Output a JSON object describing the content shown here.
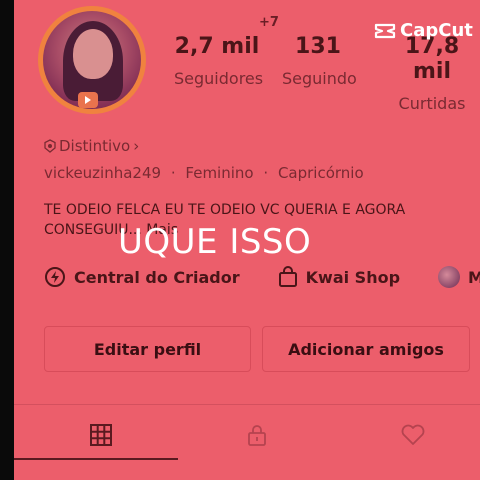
{
  "overlay": {
    "capcut_label": "CapCut",
    "caption": "UQUE ISSO"
  },
  "profile": {
    "story_badge": "+7",
    "stats": [
      {
        "value": "2,7 mil",
        "label": "Seguidores"
      },
      {
        "value": "131",
        "label": "Seguindo"
      },
      {
        "value": "17,8 mil",
        "label": "Curtidas"
      }
    ],
    "badge_label": "Distintivo",
    "badge_chevron": "›",
    "username": "vickeuzinha249",
    "gender": "Feminino",
    "sign": "Capricórnio",
    "info_separator": "·",
    "bio_line1": "TE ODEIO FELCA EU TE ODEIO VC QUERIA E AGORA",
    "bio_line2": "CONSEGUIU... Mais"
  },
  "links": [
    {
      "label": "Central do Criador",
      "icon": "lightning-icon"
    },
    {
      "label": "Kwai Shop",
      "icon": "shopping-bag-icon"
    },
    {
      "label": "Minha",
      "icon": "avatar-icon"
    }
  ],
  "actions": {
    "edit_label": "Editar perfil",
    "add_label": "Adicionar amigos"
  },
  "tabs": [
    "grid-icon",
    "lock-icon",
    "heart-icon"
  ],
  "colors": {
    "overlay_tint": "#ec5e6b",
    "avatar_ring": "#f0823f",
    "text_dark": "#4a1518"
  }
}
